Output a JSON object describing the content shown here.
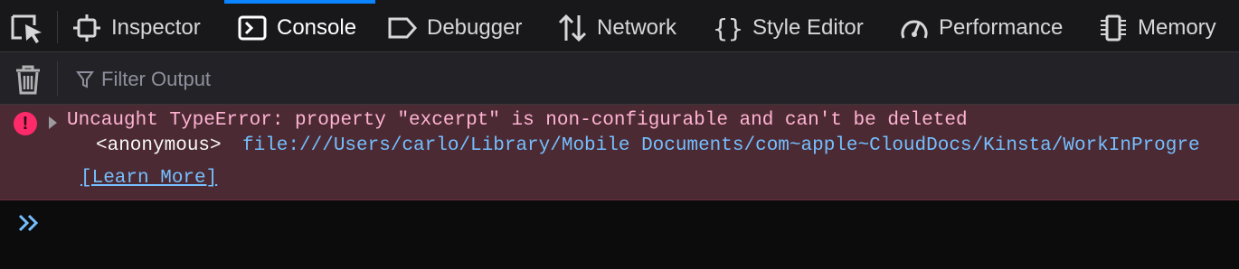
{
  "toolbar": {
    "tabs": [
      {
        "label": "Inspector",
        "icon": "inspector-icon"
      },
      {
        "label": "Console",
        "icon": "console-icon",
        "selected": true
      },
      {
        "label": "Debugger",
        "icon": "debugger-icon"
      },
      {
        "label": "Network",
        "icon": "network-icon"
      },
      {
        "label": "Style Editor",
        "icon": "style-editor-icon"
      },
      {
        "label": "Performance",
        "icon": "performance-icon"
      },
      {
        "label": "Memory",
        "icon": "memory-icon"
      }
    ],
    "accent_color": "#0a84ff"
  },
  "filter": {
    "placeholder": "Filter Output"
  },
  "console": {
    "messages": [
      {
        "level": "error",
        "text": "Uncaught TypeError: property \"excerpt\" is non-configurable and can't be deleted",
        "stack_function": "<anonymous>",
        "stack_location": "file:///Users/carlo/Library/Mobile Documents/com~apple~CloudDocs/Kinsta/WorkInProgre",
        "learn_more": "[Learn More]"
      }
    ]
  },
  "colors": {
    "error_background": "#4b2a33",
    "error_text": "#ffb3d2",
    "error_icon": "#ff2a6a",
    "link": "#75bfff"
  }
}
